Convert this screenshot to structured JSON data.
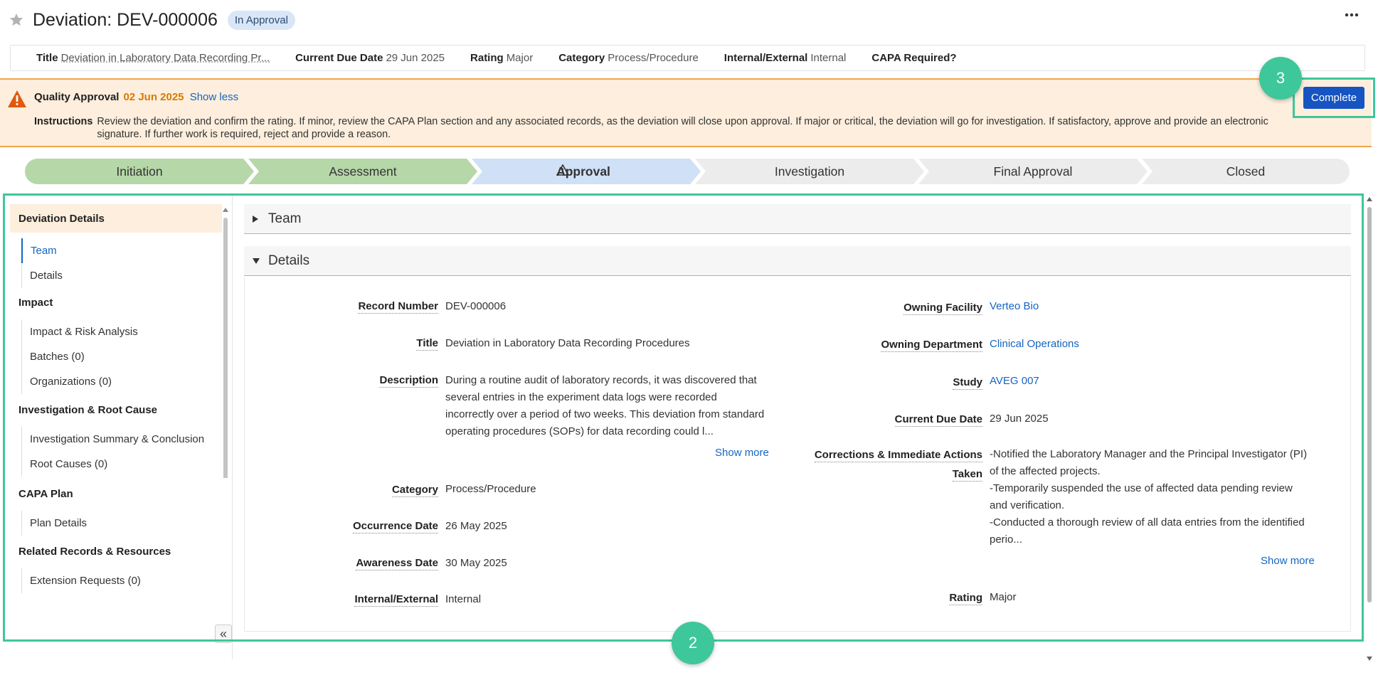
{
  "header": {
    "title": "Deviation: DEV-000006",
    "status_badge": "In Approval",
    "more_icon": "more-horizontal-icon",
    "star_icon": "star-icon"
  },
  "summary": {
    "title_label": "Title",
    "title_value": "Deviation in Laboratory Data Recording Pr...",
    "due_label": "Current Due Date",
    "due_value": "29 Jun 2025",
    "rating_label": "Rating",
    "rating_value": "Major",
    "category_label": "Category",
    "category_value": "Process/Procedure",
    "ie_label": "Internal/External",
    "ie_value": "Internal",
    "capa_label": "CAPA Required?"
  },
  "banner": {
    "heading": "Quality Approval",
    "date": "02 Jun 2025",
    "toggle": "Show less",
    "instructions_label": "Instructions",
    "instructions_text": "Review the deviation and confirm the rating. If minor, review the CAPA Plan section and any associated records, as the deviation will close upon approval. If major or critical, the deviation will go for investigation. If satisfactory, approve and provide an electronic signature. If further work is required, reject and provide a reason.",
    "complete_button": "Complete",
    "callout_number": "3"
  },
  "stages": [
    {
      "label": "Initiation",
      "state": "done"
    },
    {
      "label": "Assessment",
      "state": "done"
    },
    {
      "label": "Approval",
      "state": "current"
    },
    {
      "label": "Investigation",
      "state": "pending"
    },
    {
      "label": "Final Approval",
      "state": "pending"
    },
    {
      "label": "Closed",
      "state": "pending"
    }
  ],
  "nav": {
    "section": "Deviation Details",
    "items_top": [
      "Team",
      "Details"
    ],
    "groups": [
      {
        "title": "Impact",
        "items": [
          "Impact & Risk Analysis",
          "Batches (0)",
          "Organizations (0)"
        ]
      },
      {
        "title": "Investigation & Root Cause",
        "items": [
          "Investigation Summary & Conclusion",
          "Root Causes (0)"
        ]
      },
      {
        "title": "CAPA Plan",
        "items": [
          "Plan Details"
        ]
      },
      {
        "title": "Related Records & Resources",
        "items": [
          "Extension Requests (0)"
        ]
      }
    ],
    "collapse_icon": "double-chevron-left-icon"
  },
  "panels": {
    "team": "Team",
    "details": "Details"
  },
  "details": {
    "record_number_label": "Record Number",
    "record_number": "DEV-000006",
    "title_label": "Title",
    "title": "Deviation in Laboratory Data Recording Procedures",
    "description_label": "Description",
    "description_lines": [
      "During a routine audit of laboratory records, it was discovered that",
      "several entries in the experiment data logs were recorded",
      "incorrectly over a period of two weeks. This deviation from standard",
      "operating procedures (SOPs) for data recording could l..."
    ],
    "show_more": "Show more",
    "category_label": "Category",
    "category": "Process/Procedure",
    "occurrence_label": "Occurrence Date",
    "occurrence": "26 May 2025",
    "awareness_label": "Awareness Date",
    "awareness": "30 May 2025",
    "ie_label": "Internal/External",
    "ie": "Internal",
    "facility_label": "Owning Facility",
    "facility": "Verteo Bio",
    "department_label": "Owning Department",
    "department": "Clinical Operations",
    "study_label": "Study",
    "study": "AVEG 007",
    "due_label": "Current Due Date",
    "due": "29 Jun 2025",
    "corrections_label_1": "Corrections & Immediate Actions",
    "corrections_label_2": "Taken",
    "corrections_lines": [
      "-Notified the Laboratory Manager and the Principal Investigator (PI)",
      "of the affected projects.",
      "-Temporarily suspended the use of affected data pending review",
      "and verification.",
      "-Conducted a thorough review of all data entries from the identified",
      "perio..."
    ],
    "rating_label": "Rating",
    "rating": "Major"
  },
  "callout_main": "2",
  "colors": {
    "accent": "#3ec79a",
    "primary_button": "#1654c2",
    "banner_bg": "#fdeedd",
    "banner_border": "#f0a64a",
    "stage_done": "#b6d7a8",
    "stage_current": "#cfe0f7",
    "stage_pending": "#ececec",
    "link": "#1565c0"
  }
}
